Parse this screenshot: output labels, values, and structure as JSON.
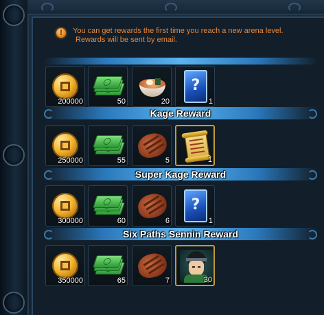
{
  "notice": {
    "icon": "warning-icon",
    "line1": "You can get rewards the first time you reach a new arena level.",
    "line2": "Rewards will be sent by email."
  },
  "tiers": [
    {
      "title": "",
      "items": [
        {
          "icon": "gold-coin-icon",
          "count": "200000"
        },
        {
          "icon": "cash-stack-icon",
          "count": "50"
        },
        {
          "icon": "ramen-bowl-icon",
          "count": "20"
        },
        {
          "icon": "mystery-card-icon",
          "count": "1"
        }
      ]
    },
    {
      "title": "Kage Reward",
      "items": [
        {
          "icon": "gold-coin-icon",
          "count": "250000"
        },
        {
          "icon": "cash-stack-icon",
          "count": "55"
        },
        {
          "icon": "steak-icon",
          "count": "5"
        },
        {
          "icon": "scroll-icon",
          "count": "1"
        }
      ]
    },
    {
      "title": "Super Kage Reward",
      "items": [
        {
          "icon": "gold-coin-icon",
          "count": "300000"
        },
        {
          "icon": "cash-stack-icon",
          "count": "60"
        },
        {
          "icon": "steak-icon",
          "count": "6"
        },
        {
          "icon": "mystery-card-icon",
          "count": "1"
        }
      ]
    },
    {
      "title": "Six Paths Sennin Reward",
      "items": [
        {
          "icon": "gold-coin-icon",
          "count": "350000"
        },
        {
          "icon": "cash-stack-icon",
          "count": "65"
        },
        {
          "icon": "steak-icon",
          "count": "7"
        },
        {
          "icon": "ninja-portrait-icon",
          "count": "30"
        }
      ]
    }
  ]
}
